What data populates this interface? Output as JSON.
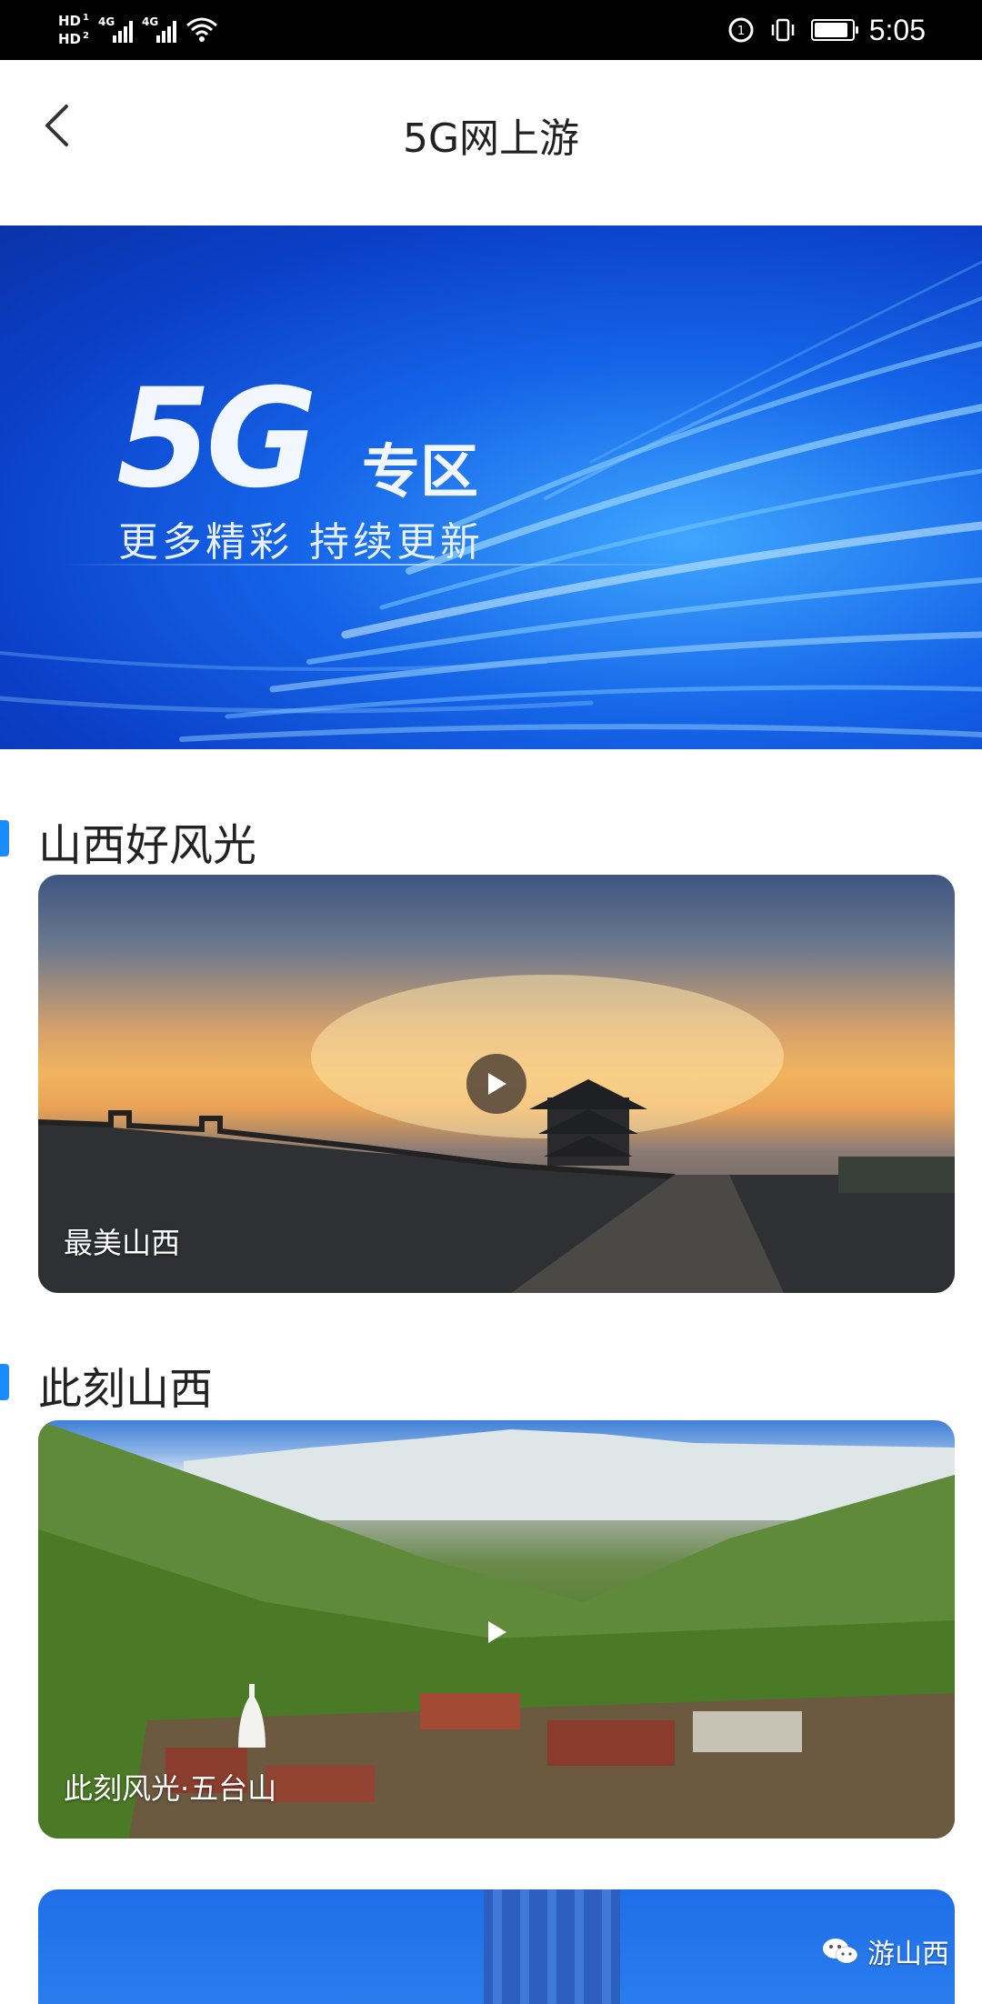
{
  "status_bar": {
    "sim1": "HD",
    "sim1_index": "1",
    "sim2": "HD",
    "sim2_index": "2",
    "network1": "4G",
    "network2": "4G",
    "time": "5:05",
    "icons": [
      "wifi-icon",
      "data-saver-icon",
      "vibrate-icon",
      "battery-icon"
    ],
    "battery_level": 0.9
  },
  "nav": {
    "back_icon": "chevron-left-icon",
    "title": "5G网上游"
  },
  "banner": {
    "headline": "5G",
    "headline_suffix": "专区",
    "subtitle": "更多精彩 持续更新"
  },
  "sections": [
    {
      "title": "山西好风光",
      "card_label": "最美山西",
      "has_play": true
    },
    {
      "title": "此刻山西",
      "card_label": "此刻风光·五台山",
      "has_play": true
    }
  ],
  "watermark": {
    "icon": "wechat-icon",
    "text": "游山西"
  },
  "colors": {
    "accent": "#1a8cff",
    "status_bar_bg": "#000000",
    "banner_blue": "#1565e8"
  }
}
